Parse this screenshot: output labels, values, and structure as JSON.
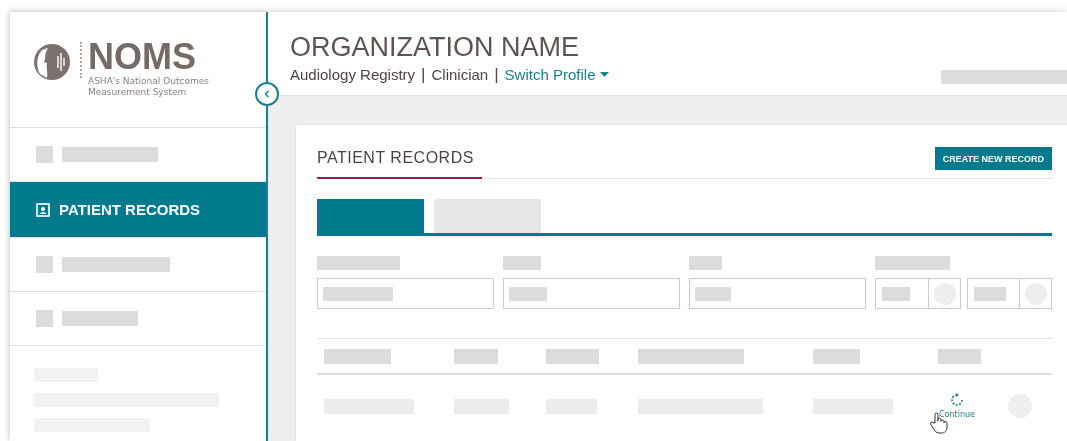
{
  "logo": {
    "name": "NOMS",
    "tagline": "ASHA's National Outcomes Measurement System"
  },
  "sidebar": {
    "items": [
      {
        "kind": "placeholder",
        "selected": false
      },
      {
        "kind": "link",
        "label": "PATIENT RECORDS",
        "selected": true
      },
      {
        "kind": "placeholder",
        "selected": false
      },
      {
        "kind": "placeholder",
        "selected": false
      }
    ]
  },
  "header": {
    "title": "ORGANIZATION NAME",
    "breadcrumb": [
      {
        "kind": "text",
        "label": "Audiology Registry"
      },
      {
        "kind": "separator",
        "label": "|"
      },
      {
        "kind": "text",
        "label": "Clinician"
      },
      {
        "kind": "separator",
        "label": "|"
      },
      {
        "kind": "link",
        "label": "Switch Profile"
      }
    ]
  },
  "card": {
    "title": "PATIENT RECORDS",
    "button": "CREATE NEW RECORD",
    "tabs": [
      {
        "selected": true
      },
      {
        "selected": false
      }
    ],
    "row_action": "Continue"
  }
}
